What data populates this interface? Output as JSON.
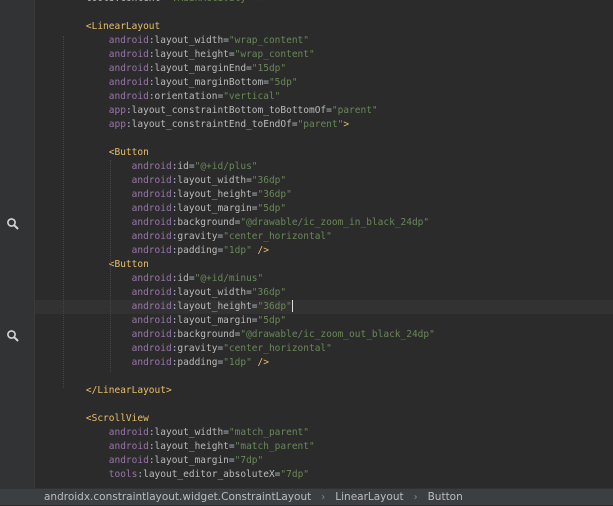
{
  "editor": {
    "lines": [
      {
        "indent": "    ",
        "parts": [
          {
            "t": "attr",
            "v": "tools"
          },
          {
            "t": "punc",
            "v": ":"
          },
          {
            "t": "attr",
            "v": "context"
          },
          {
            "t": "punc",
            "v": "="
          },
          {
            "t": "val",
            "v": "\".MainActivity\" >"
          }
        ]
      },
      {
        "indent": "",
        "parts": []
      },
      {
        "indent": "    ",
        "parts": [
          {
            "t": "tag",
            "v": "<LinearLayout"
          }
        ]
      },
      {
        "indent": "        ",
        "parts": [
          {
            "t": "ns",
            "v": "android"
          },
          {
            "t": "punc",
            "v": ":"
          },
          {
            "t": "attr",
            "v": "layout_width"
          },
          {
            "t": "punc",
            "v": "="
          },
          {
            "t": "val",
            "v": "\"wrap_content\""
          }
        ]
      },
      {
        "indent": "        ",
        "parts": [
          {
            "t": "ns",
            "v": "android"
          },
          {
            "t": "punc",
            "v": ":"
          },
          {
            "t": "attr",
            "v": "layout_height"
          },
          {
            "t": "punc",
            "v": "="
          },
          {
            "t": "val",
            "v": "\"wrap_content\""
          }
        ]
      },
      {
        "indent": "        ",
        "parts": [
          {
            "t": "ns",
            "v": "android"
          },
          {
            "t": "punc",
            "v": ":"
          },
          {
            "t": "attr",
            "v": "layout_marginEnd"
          },
          {
            "t": "punc",
            "v": "="
          },
          {
            "t": "val",
            "v": "\"15dp\""
          }
        ]
      },
      {
        "indent": "        ",
        "parts": [
          {
            "t": "ns",
            "v": "android"
          },
          {
            "t": "punc",
            "v": ":"
          },
          {
            "t": "attr",
            "v": "layout_marginBottom"
          },
          {
            "t": "punc",
            "v": "="
          },
          {
            "t": "val",
            "v": "\"5dp\""
          }
        ]
      },
      {
        "indent": "        ",
        "parts": [
          {
            "t": "ns",
            "v": "android"
          },
          {
            "t": "punc",
            "v": ":"
          },
          {
            "t": "attr",
            "v": "orientation"
          },
          {
            "t": "punc",
            "v": "="
          },
          {
            "t": "val",
            "v": "\"vertical\""
          }
        ]
      },
      {
        "indent": "        ",
        "parts": [
          {
            "t": "ns",
            "v": "app"
          },
          {
            "t": "punc",
            "v": ":"
          },
          {
            "t": "attr",
            "v": "layout_constraintBottom_toBottomOf"
          },
          {
            "t": "punc",
            "v": "="
          },
          {
            "t": "val",
            "v": "\"parent\""
          }
        ]
      },
      {
        "indent": "        ",
        "parts": [
          {
            "t": "ns",
            "v": "app"
          },
          {
            "t": "punc",
            "v": ":"
          },
          {
            "t": "attr",
            "v": "layout_constraintEnd_toEndOf"
          },
          {
            "t": "punc",
            "v": "="
          },
          {
            "t": "val",
            "v": "\"parent\""
          },
          {
            "t": "tag",
            "v": ">"
          }
        ]
      },
      {
        "indent": "",
        "parts": []
      },
      {
        "indent": "        ",
        "parts": [
          {
            "t": "tag",
            "v": "<Button"
          }
        ]
      },
      {
        "indent": "            ",
        "parts": [
          {
            "t": "ns",
            "v": "android"
          },
          {
            "t": "punc",
            "v": ":"
          },
          {
            "t": "attr",
            "v": "id"
          },
          {
            "t": "punc",
            "v": "="
          },
          {
            "t": "val",
            "v": "\"@+id/plus\""
          }
        ]
      },
      {
        "indent": "            ",
        "parts": [
          {
            "t": "ns",
            "v": "android"
          },
          {
            "t": "punc",
            "v": ":"
          },
          {
            "t": "attr",
            "v": "layout_width"
          },
          {
            "t": "punc",
            "v": "="
          },
          {
            "t": "val",
            "v": "\"36dp\""
          }
        ]
      },
      {
        "indent": "            ",
        "parts": [
          {
            "t": "ns",
            "v": "android"
          },
          {
            "t": "punc",
            "v": ":"
          },
          {
            "t": "attr",
            "v": "layout_height"
          },
          {
            "t": "punc",
            "v": "="
          },
          {
            "t": "val",
            "v": "\"36dp\""
          }
        ]
      },
      {
        "indent": "            ",
        "parts": [
          {
            "t": "ns",
            "v": "android"
          },
          {
            "t": "punc",
            "v": ":"
          },
          {
            "t": "attr",
            "v": "layout_margin"
          },
          {
            "t": "punc",
            "v": "="
          },
          {
            "t": "val",
            "v": "\"5dp\""
          }
        ]
      },
      {
        "indent": "            ",
        "parts": [
          {
            "t": "ns",
            "v": "android"
          },
          {
            "t": "punc",
            "v": ":"
          },
          {
            "t": "attr",
            "v": "background"
          },
          {
            "t": "punc",
            "v": "="
          },
          {
            "t": "val",
            "v": "\"@drawable/ic_zoom_in_black_24dp\""
          }
        ]
      },
      {
        "indent": "            ",
        "parts": [
          {
            "t": "ns",
            "v": "android"
          },
          {
            "t": "punc",
            "v": ":"
          },
          {
            "t": "attr",
            "v": "gravity"
          },
          {
            "t": "punc",
            "v": "="
          },
          {
            "t": "val",
            "v": "\"center_horizontal\""
          }
        ]
      },
      {
        "indent": "            ",
        "parts": [
          {
            "t": "ns",
            "v": "android"
          },
          {
            "t": "punc",
            "v": ":"
          },
          {
            "t": "attr",
            "v": "padding"
          },
          {
            "t": "punc",
            "v": "="
          },
          {
            "t": "val",
            "v": "\"1dp\""
          },
          {
            "t": "tag",
            "v": " />"
          }
        ]
      },
      {
        "indent": "        ",
        "parts": [
          {
            "t": "tag",
            "v": "<Button"
          }
        ]
      },
      {
        "indent": "            ",
        "parts": [
          {
            "t": "ns",
            "v": "android"
          },
          {
            "t": "punc",
            "v": ":"
          },
          {
            "t": "attr",
            "v": "id"
          },
          {
            "t": "punc",
            "v": "="
          },
          {
            "t": "val",
            "v": "\"@+id/minus\""
          }
        ]
      },
      {
        "indent": "            ",
        "parts": [
          {
            "t": "ns",
            "v": "android"
          },
          {
            "t": "punc",
            "v": ":"
          },
          {
            "t": "attr",
            "v": "layout_width"
          },
          {
            "t": "punc",
            "v": "="
          },
          {
            "t": "val",
            "v": "\"36dp\""
          }
        ]
      },
      {
        "indent": "            ",
        "current": true,
        "parts": [
          {
            "t": "ns",
            "v": "android"
          },
          {
            "t": "punc",
            "v": ":"
          },
          {
            "t": "attr",
            "v": "layout_height"
          },
          {
            "t": "punc",
            "v": "="
          },
          {
            "t": "val",
            "v": "\"36dp\""
          },
          {
            "t": "caret",
            "v": ""
          }
        ]
      },
      {
        "indent": "            ",
        "parts": [
          {
            "t": "ns",
            "v": "android"
          },
          {
            "t": "punc",
            "v": ":"
          },
          {
            "t": "attr",
            "v": "layout_margin"
          },
          {
            "t": "punc",
            "v": "="
          },
          {
            "t": "val",
            "v": "\"5dp\""
          }
        ]
      },
      {
        "indent": "            ",
        "parts": [
          {
            "t": "ns",
            "v": "android"
          },
          {
            "t": "punc",
            "v": ":"
          },
          {
            "t": "attr",
            "v": "background"
          },
          {
            "t": "punc",
            "v": "="
          },
          {
            "t": "val",
            "v": "\"@drawable/ic_zoom_out_black_24dp\""
          }
        ]
      },
      {
        "indent": "            ",
        "parts": [
          {
            "t": "ns",
            "v": "android"
          },
          {
            "t": "punc",
            "v": ":"
          },
          {
            "t": "attr",
            "v": "gravity"
          },
          {
            "t": "punc",
            "v": "="
          },
          {
            "t": "val",
            "v": "\"center_horizontal\""
          }
        ]
      },
      {
        "indent": "            ",
        "parts": [
          {
            "t": "ns",
            "v": "android"
          },
          {
            "t": "punc",
            "v": ":"
          },
          {
            "t": "attr",
            "v": "padding"
          },
          {
            "t": "punc",
            "v": "="
          },
          {
            "t": "val",
            "v": "\"1dp\""
          },
          {
            "t": "tag",
            "v": " />"
          }
        ]
      },
      {
        "indent": "",
        "parts": []
      },
      {
        "indent": "    ",
        "parts": [
          {
            "t": "tag",
            "v": "</LinearLayout>"
          }
        ]
      },
      {
        "indent": "",
        "parts": []
      },
      {
        "indent": "    ",
        "parts": [
          {
            "t": "tag",
            "v": "<ScrollView"
          }
        ]
      },
      {
        "indent": "        ",
        "parts": [
          {
            "t": "ns",
            "v": "android"
          },
          {
            "t": "punc",
            "v": ":"
          },
          {
            "t": "attr",
            "v": "layout_width"
          },
          {
            "t": "punc",
            "v": "="
          },
          {
            "t": "val",
            "v": "\"match_parent\""
          }
        ]
      },
      {
        "indent": "        ",
        "parts": [
          {
            "t": "ns",
            "v": "android"
          },
          {
            "t": "punc",
            "v": ":"
          },
          {
            "t": "attr",
            "v": "layout_height"
          },
          {
            "t": "punc",
            "v": "="
          },
          {
            "t": "val",
            "v": "\"match_parent\""
          }
        ]
      },
      {
        "indent": "        ",
        "parts": [
          {
            "t": "ns",
            "v": "android"
          },
          {
            "t": "punc",
            "v": ":"
          },
          {
            "t": "attr",
            "v": "layout_margin"
          },
          {
            "t": "punc",
            "v": "="
          },
          {
            "t": "val",
            "v": "\"7dp\""
          }
        ]
      },
      {
        "indent": "        ",
        "parts": [
          {
            "t": "ns",
            "v": "tools"
          },
          {
            "t": "punc",
            "v": ":"
          },
          {
            "t": "attr",
            "v": "layout_editor_absoluteX"
          },
          {
            "t": "punc",
            "v": "="
          },
          {
            "t": "val",
            "v": "\"7dp\""
          }
        ]
      }
    ]
  },
  "gutter": {
    "icons": [
      {
        "name": "zoom-in-drawable-preview-icon",
        "line": 16
      },
      {
        "name": "zoom-out-drawable-preview-icon",
        "line": 24
      }
    ]
  },
  "breadcrumb": {
    "items": [
      "androidx.constraintlayout.widget.ConstraintLayout",
      "LinearLayout",
      "Button"
    ],
    "separator": "›"
  },
  "colors": {
    "background": "#2b2b2b",
    "tag": "#e8bf6a",
    "namespace": "#9876aa",
    "attribute": "#bababa",
    "value": "#6a8759"
  }
}
